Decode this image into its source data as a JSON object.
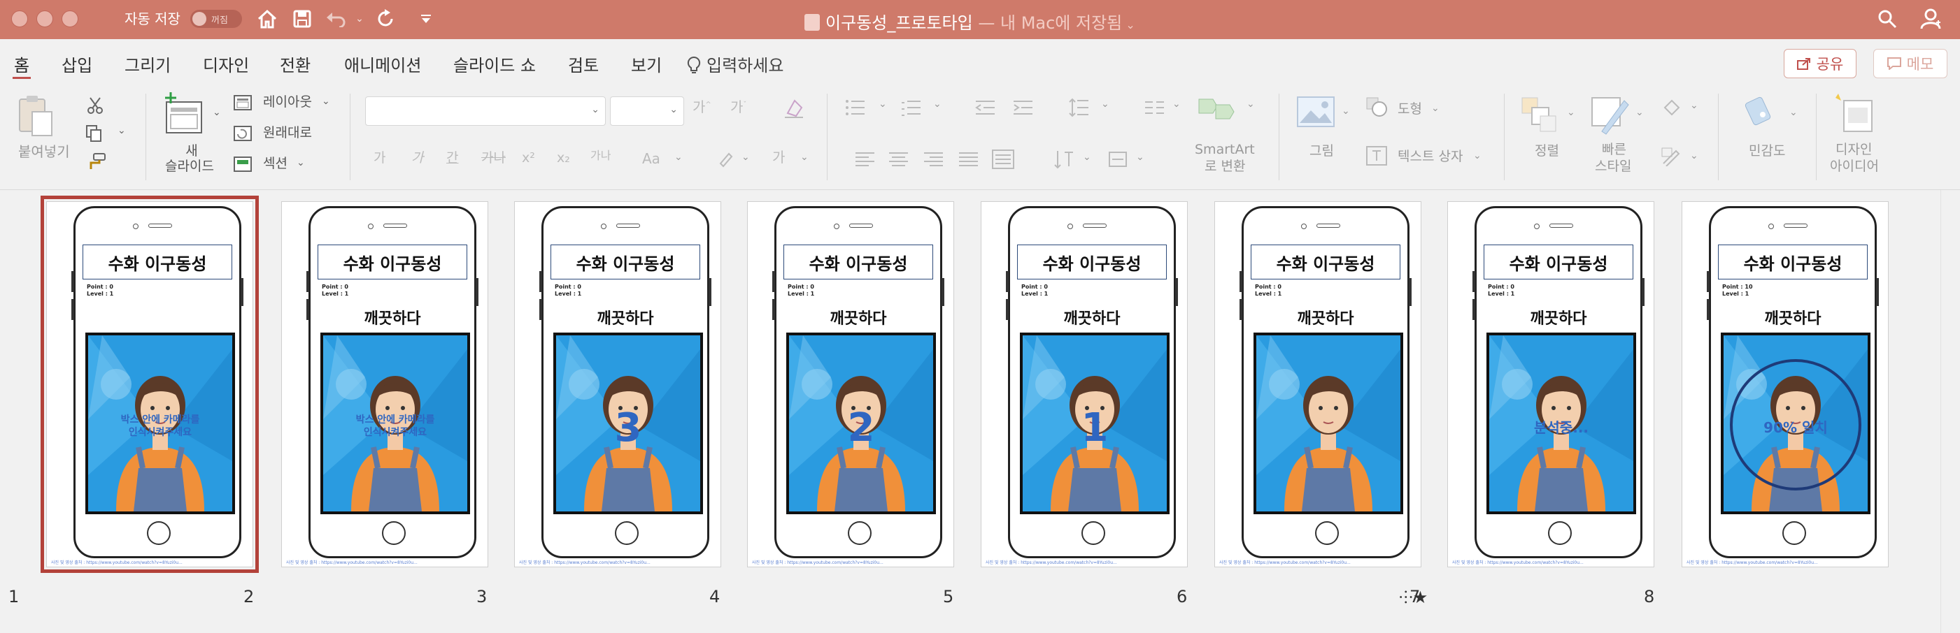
{
  "titlebar": {
    "autosave_label": "자동 저장",
    "autosave_state": "꺼짐",
    "doc_title": "이구동성_프로토타입",
    "doc_location": " — 내 Mac에 저장됨"
  },
  "tabs": [
    "홈",
    "삽입",
    "그리기",
    "디자인",
    "전환",
    "애니메이션",
    "슬라이드 쇼",
    "검토",
    "보기"
  ],
  "tell_me": "입력하세요",
  "share_label": "공유",
  "memo_label": "메모",
  "ribbon": {
    "paste": "붙여넣기",
    "new_slide": [
      "새",
      "슬라이드"
    ],
    "layout": "레이아웃",
    "reset": "원래대로",
    "section": "섹션",
    "smartart": [
      "SmartArt",
      "로 변환"
    ],
    "picture": "그림",
    "shape": "도형",
    "textbox": "텍스트 상자",
    "arrange": "정렬",
    "quick_styles": [
      "빠른",
      "스타일"
    ],
    "sensitivity": "민감도",
    "design_ideas": [
      "디자인",
      "아이디어"
    ],
    "font_buttons": [
      "가",
      "가",
      "간",
      "가나",
      "x²",
      "x₂",
      "가나",
      "Aa",
      "가"
    ]
  },
  "slides": [
    {
      "number": "1",
      "title": "수화 이구동성",
      "point": "Point : 0",
      "level": "Level : 1",
      "word": "",
      "overlay": "박스 안에 카메라를\n인식시켜주세요",
      "overlay_type": "prompt",
      "credit": "사진 및 영상 출처 : https://www.youtube.com/watch?v=8Yuzi0u...",
      "selected": true,
      "star": false
    },
    {
      "number": "2",
      "title": "수화 이구동성",
      "point": "Point : 0",
      "level": "Level : 1",
      "word": "깨끗하다",
      "overlay": "박스 안에 카메라를\n인식시켜주세요",
      "overlay_type": "prompt",
      "credit": "사진 및 영상 출처 : https://www.youtube.com/watch?v=8Yuzi0u...",
      "selected": false,
      "star": false
    },
    {
      "number": "3",
      "title": "수화 이구동성",
      "point": "Point : 0",
      "level": "Level : 1",
      "word": "깨끗하다",
      "overlay": "3",
      "overlay_type": "count",
      "credit": "사진 및 영상 출처 : https://www.youtube.com/watch?v=8Yuzi0u...",
      "selected": false,
      "star": false
    },
    {
      "number": "4",
      "title": "수화 이구동성",
      "point": "Point : 0",
      "level": "Level : 1",
      "word": "깨끗하다",
      "overlay": "2",
      "overlay_type": "count",
      "credit": "사진 및 영상 출처 : https://www.youtube.com/watch?v=8Yuzi0u...",
      "selected": false,
      "star": false
    },
    {
      "number": "5",
      "title": "수화 이구동성",
      "point": "Point : 0",
      "level": "Level : 1",
      "word": "깨끗하다",
      "overlay": "1",
      "overlay_type": "count",
      "credit": "사진 및 영상 출처 : https://www.youtube.com/watch?v=8Yuzi0u...",
      "selected": false,
      "star": false
    },
    {
      "number": "6",
      "title": "수화 이구동성",
      "point": "Point : 0",
      "level": "Level : 1",
      "word": "깨끗하다",
      "overlay": "",
      "overlay_type": "none",
      "credit": "사진 및 영상 출처 : https://www.youtube.com/watch?v=8Yuzi0u...",
      "selected": false,
      "star": true
    },
    {
      "number": "7",
      "title": "수화 이구동성",
      "point": "Point : 0",
      "level": "Level : 1",
      "word": "깨끗하다",
      "overlay": "분석중...",
      "overlay_type": "analyze",
      "credit": "사진 및 영상 출처 : https://www.youtube.com/watch?v=8Yuzi0u...",
      "selected": false,
      "star": false
    },
    {
      "number": "8",
      "title": "수화 이구동성",
      "point": "Point : 10",
      "level": "Level : 1",
      "word": "깨끗하다",
      "overlay": "90% 일치",
      "overlay_type": "match",
      "credit": "사진 및 영상 출처 : https://www.youtube.com/watch?v=8Yuzi0u...",
      "selected": false,
      "star": false
    }
  ],
  "colors": {
    "titlebar": "#cf7a6a",
    "accent": "#c0504d",
    "overlay_blue": "#2f66c1",
    "match_circle": "#1e3a78"
  }
}
